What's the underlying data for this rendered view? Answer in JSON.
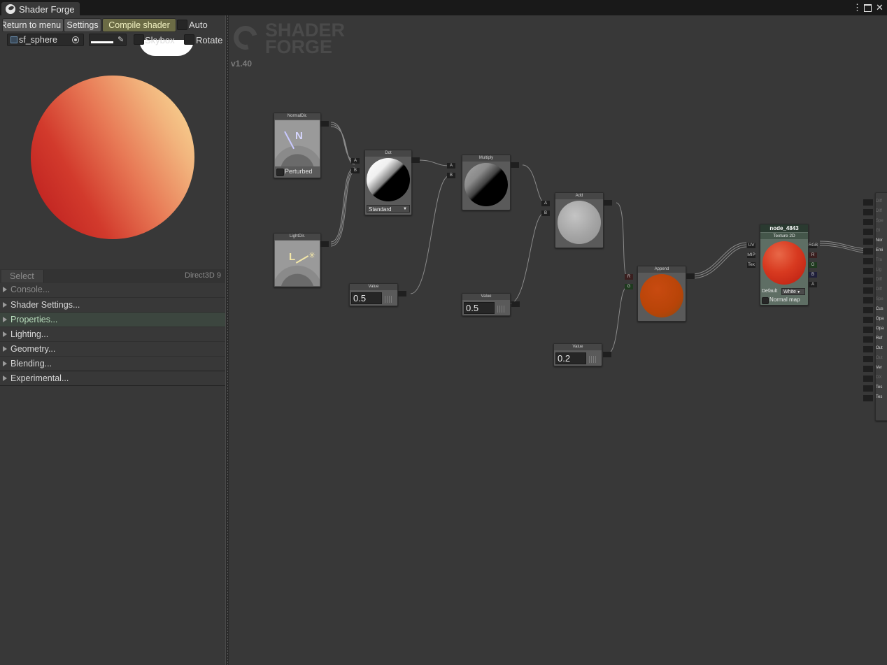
{
  "window": {
    "title": "Shader Forge",
    "controls": [
      "⋮",
      "🗖",
      "✕"
    ]
  },
  "toolbar": {
    "return_label": "Return to menu",
    "settings_label": "Settings",
    "compile_label": "Compile shader",
    "auto_label": "Auto"
  },
  "preview_bar": {
    "mesh_value": "sf_sphere",
    "skybox_label": "Skybox",
    "rotate_label": "Rotate"
  },
  "select_bar": {
    "select_label": "Select",
    "renderer_label": "Direct3D 9"
  },
  "sections": [
    {
      "label": "Console..."
    },
    {
      "label": "Shader Settings..."
    },
    {
      "label": "Properties..."
    },
    {
      "label": "Lighting..."
    },
    {
      "label": "Geometry..."
    },
    {
      "label": "Blending..."
    },
    {
      "label": "Experimental..."
    }
  ],
  "branding": {
    "logo_line1": "SHADER",
    "logo_line2": "FORGE",
    "version": "v1.40"
  },
  "nodes": {
    "normaldir": {
      "title": "NormalDir.",
      "glyph": "N",
      "checkbox_label": "Perturbed"
    },
    "lightdir": {
      "title": "LightDir.",
      "glyph": "L"
    },
    "dot": {
      "title": "Dot",
      "in_a": "A",
      "in_b": "B",
      "dropdown": "Standard"
    },
    "multiply": {
      "title": "Multiply",
      "in_a": "A",
      "in_b": "B"
    },
    "add": {
      "title": "Add",
      "in_a": "A",
      "in_b": "B"
    },
    "value1": {
      "title": "Value",
      "value": "0.5"
    },
    "value2": {
      "title": "Value",
      "value": "0.5"
    },
    "value3": {
      "title": "Value",
      "value": "0.2"
    },
    "append": {
      "title": "Append",
      "in_r": "R",
      "in_g": "G"
    },
    "texture": {
      "name": "node_4843",
      "type": "Texture 2D",
      "inputs": [
        "UV",
        "MIP",
        "Tex"
      ],
      "outputs": [
        "RGB",
        "R",
        "G",
        "B",
        "A"
      ],
      "default_label": "Default",
      "default_value": "White",
      "normal_label": "Normal map"
    }
  },
  "main_node_ports": [
    "Diff",
    "Diff",
    "Spe",
    "Gl",
    "Nor",
    "Emi",
    "Tra",
    "Lig",
    "Diff",
    "Diff",
    "Spe",
    "Cus",
    "Opa",
    "Opa",
    "Ref",
    "Out",
    "Out",
    "Ver",
    "DX",
    "Tes",
    "Tes"
  ]
}
